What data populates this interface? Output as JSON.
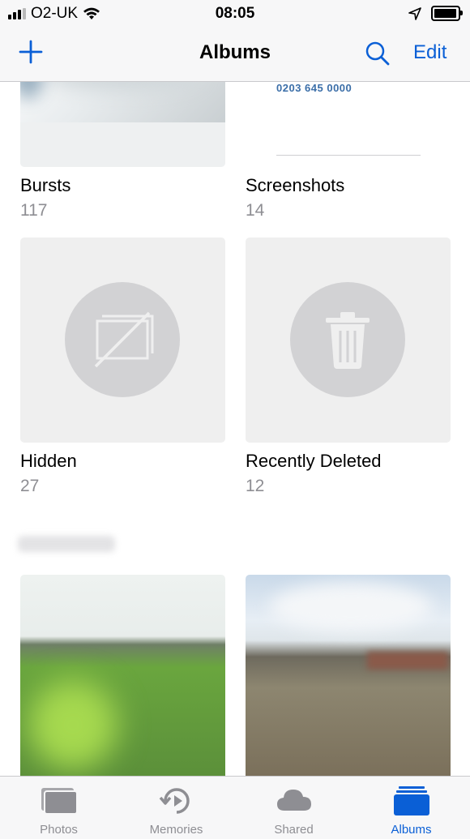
{
  "status_bar": {
    "carrier": "O2-UK",
    "time": "08:05",
    "signal_bars_active": 3,
    "signal_bars_total": 4
  },
  "nav": {
    "title": "Albums",
    "edit_label": "Edit",
    "add_icon": "plus-icon",
    "search_icon": "search-icon"
  },
  "albums": [
    {
      "name": "Bursts",
      "count": "117"
    },
    {
      "name": "Screenshots",
      "count": "14",
      "preview_text": "0203 645 0000"
    },
    {
      "name": "Hidden",
      "count": "27",
      "icon": "hidden-icon"
    },
    {
      "name": "Recently Deleted",
      "count": "12",
      "icon": "trash-icon"
    }
  ],
  "tabs": [
    {
      "label": "Photos",
      "icon": "photos-icon"
    },
    {
      "label": "Memories",
      "icon": "memories-icon"
    },
    {
      "label": "Shared",
      "icon": "cloud-icon"
    },
    {
      "label": "Albums",
      "icon": "albums-icon",
      "active": true
    }
  ],
  "colors": {
    "accent": "#0a5fd6",
    "secondary_text": "#8e8e93",
    "placeholder_bg": "#efefef",
    "placeholder_circle": "#d2d2d4"
  }
}
